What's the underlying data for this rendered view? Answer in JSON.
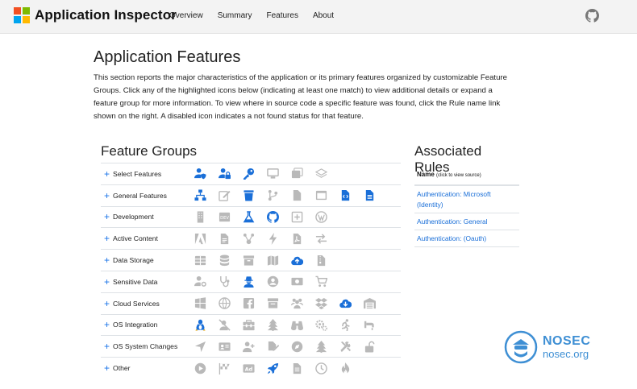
{
  "nav": {
    "brand": "Application Inspector",
    "links": [
      "Overview",
      "Summary",
      "Features",
      "About"
    ]
  },
  "main": {
    "title": "Application Features",
    "intro": "This section reports the major characteristics of the application or its primary features organized by customizable Feature Groups. Click any of the highlighted icons below (indicating at least one match) to view additional details or expand a feature group for more information. To view where in source code a specific feature was found, click the Rule name link shown on the right. A disabled icon indicates a not found status for that feature."
  },
  "feature_groups": {
    "title": "Feature Groups",
    "rows": [
      {
        "label": "Select Features",
        "icons": [
          [
            "user-shield-icon",
            1
          ],
          [
            "user-lock-icon",
            1
          ],
          [
            "key-icon",
            1
          ],
          [
            "desktop-icon",
            0
          ],
          [
            "images-icon",
            0
          ],
          [
            "layers-icon",
            0
          ]
        ]
      },
      {
        "label": "General Features",
        "icons": [
          [
            "network-icon",
            1
          ],
          [
            "edit-icon",
            0
          ],
          [
            "trash-icon",
            1
          ],
          [
            "branch-icon",
            0
          ],
          [
            "file-icon",
            0
          ],
          [
            "window-icon",
            0
          ],
          [
            "file-code-icon",
            1
          ],
          [
            "file-text-icon",
            1
          ]
        ]
      },
      {
        "label": "Development",
        "icons": [
          [
            "building-icon",
            0
          ],
          [
            "dev-badge-icon",
            0
          ],
          [
            "flask-icon",
            1
          ],
          [
            "github-icon",
            1
          ],
          [
            "plus-square-icon",
            0
          ],
          [
            "wordpress-icon",
            0
          ]
        ]
      },
      {
        "label": "Active Content",
        "icons": [
          [
            "adobe-icon",
            0
          ],
          [
            "file-alt-icon",
            0
          ],
          [
            "connector-icon",
            0
          ],
          [
            "bolt-icon",
            0
          ],
          [
            "pdf-icon",
            0
          ],
          [
            "exchange-icon",
            0
          ]
        ]
      },
      {
        "label": "Data Storage",
        "icons": [
          [
            "table-icon",
            0
          ],
          [
            "database-icon",
            0
          ],
          [
            "archive-icon",
            0
          ],
          [
            "map-icon",
            0
          ],
          [
            "cloud-upload-icon",
            1
          ],
          [
            "file-archive-icon",
            0
          ]
        ]
      },
      {
        "label": "Sensitive Data",
        "icons": [
          [
            "user-cog-icon",
            0
          ],
          [
            "stethoscope-icon",
            0
          ],
          [
            "user-secret-icon",
            1
          ],
          [
            "user-circle-icon",
            0
          ],
          [
            "money-icon",
            0
          ],
          [
            "cart-icon",
            0
          ]
        ]
      },
      {
        "label": "Cloud Services",
        "icons": [
          [
            "windows-icon",
            0
          ],
          [
            "globe-icon",
            0
          ],
          [
            "facebook-icon",
            0
          ],
          [
            "mail-box-icon",
            0
          ],
          [
            "users-icon",
            0
          ],
          [
            "dropbox-icon",
            0
          ],
          [
            "cloud-download-icon",
            1
          ],
          [
            "warehouse-icon",
            0
          ]
        ]
      },
      {
        "label": "OS Integration",
        "icons": [
          [
            "linux-icon",
            1
          ],
          [
            "no-user-icon",
            0
          ],
          [
            "toolbox-icon",
            0
          ],
          [
            "tree-icon",
            0
          ],
          [
            "binoculars-icon",
            0
          ],
          [
            "cogs-icon",
            0
          ],
          [
            "running-icon",
            0
          ],
          [
            "faucet-icon",
            0
          ]
        ]
      },
      {
        "label": "OS System Changes",
        "icons": [
          [
            "location-arrow-icon",
            0
          ],
          [
            "id-card-icon",
            0
          ],
          [
            "user-plus-icon",
            0
          ],
          [
            "file-signature-icon",
            0
          ],
          [
            "compass-icon",
            0
          ],
          [
            "tree-icon",
            0
          ],
          [
            "tools-icon",
            0
          ],
          [
            "unlock-icon",
            0
          ]
        ]
      },
      {
        "label": "Other",
        "icons": [
          [
            "play-icon",
            0
          ],
          [
            "flag-checkered-icon",
            0
          ],
          [
            "ad-icon",
            0
          ],
          [
            "rocket-icon",
            1
          ],
          [
            "file-lines-icon",
            0
          ],
          [
            "clock-icon",
            0
          ],
          [
            "fire-icon",
            0
          ]
        ]
      }
    ]
  },
  "rules": {
    "title": "Associated Rules",
    "header": "Name",
    "header_note": "(click to view source)",
    "links": [
      "Authentication: Microsoft (Identity)",
      "Authentication: General",
      "Authentication: (Oauth)"
    ]
  },
  "watermark": {
    "line1": "NOSEC",
    "line2": "nosec.org"
  },
  "colors": {
    "active": "#1a6fd8",
    "disabled": "#b9b9b9",
    "accent": "#3e8fd4"
  }
}
